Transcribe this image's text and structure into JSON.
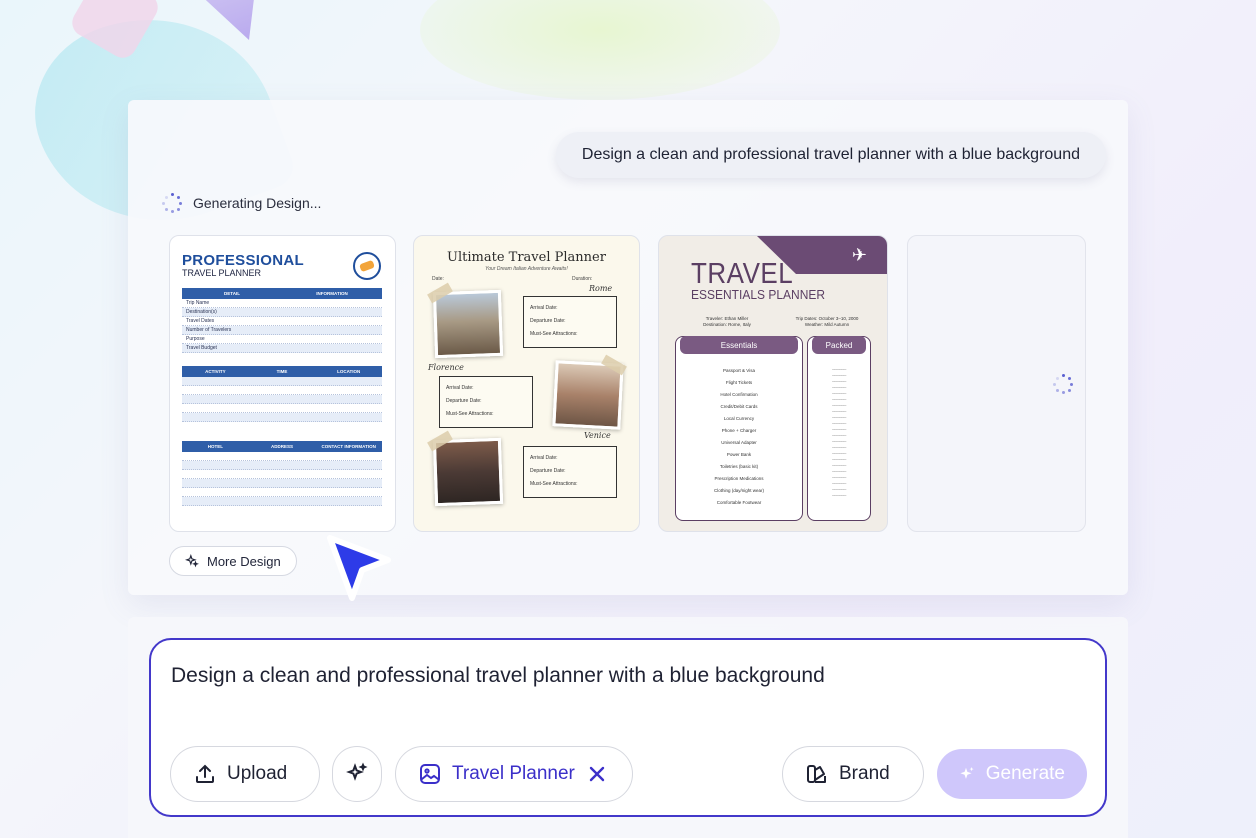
{
  "header": {
    "prompt": "Design a clean and professional travel planner with a blue background",
    "status": "Generating Design..."
  },
  "designs": {
    "card1": {
      "title": "PROFESSIONAL",
      "subtitle": "TRAVEL PLANNER",
      "table1_headers": [
        "DETAIL",
        "INFORMATION"
      ],
      "table1_rows": [
        "Trip Name",
        "Destination(s)",
        "Travel Dates",
        "Number of Travelers",
        "Purpose",
        "Travel Budget"
      ],
      "table2_headers": [
        "ACTIVITY",
        "TIME",
        "LOCATION"
      ],
      "table3_headers": [
        "HOTEL",
        "ADDRESS",
        "CONTACT INFORMATION"
      ]
    },
    "card2": {
      "title": "Ultimate Travel Planner",
      "subtitle": "Your Dream Italian Adventure Awaits!",
      "date_label": "Date:",
      "duration_label": "Duration:",
      "cities": [
        "Rome",
        "Florence",
        "Venice"
      ],
      "arrival": "Arrival Date:",
      "departure": "Departure Date:",
      "attractions": "Must-See Attractions:"
    },
    "card3": {
      "title": "TRAVEL",
      "subtitle": "ESSENTIALS PLANNER",
      "traveler": "Traveler: Ethan Miller",
      "destination": "Destination: Rome, Italy",
      "trip_dates": "Trip Dates: October 3–10, 2000",
      "weather": "Weather: Mild Autumn",
      "col_essentials": "Essentials",
      "col_packed": "Packed",
      "items": [
        "Passport & Visa",
        "Flight Tickets",
        "Hotel Confirmation",
        "Credit/Debit Cards",
        "Local Currency",
        "Phone + Charger",
        "Universal Adapter",
        "Power Bank",
        "Toiletries (basic kit)",
        "Prescription Medications",
        "Clothing (day/night wear)",
        "Comfortable Footwear"
      ]
    }
  },
  "more_design_label": "More Design",
  "composer": {
    "text": "Design a clean and professional travel planner with a blue background",
    "upload_label": "Upload",
    "tag_label": "Travel Planner",
    "brand_label": "Brand",
    "generate_label": "Generate"
  },
  "colors": {
    "accent": "#4338ca",
    "generate_disabled": "#cfc7fb",
    "cursor": "#2d3be8"
  }
}
